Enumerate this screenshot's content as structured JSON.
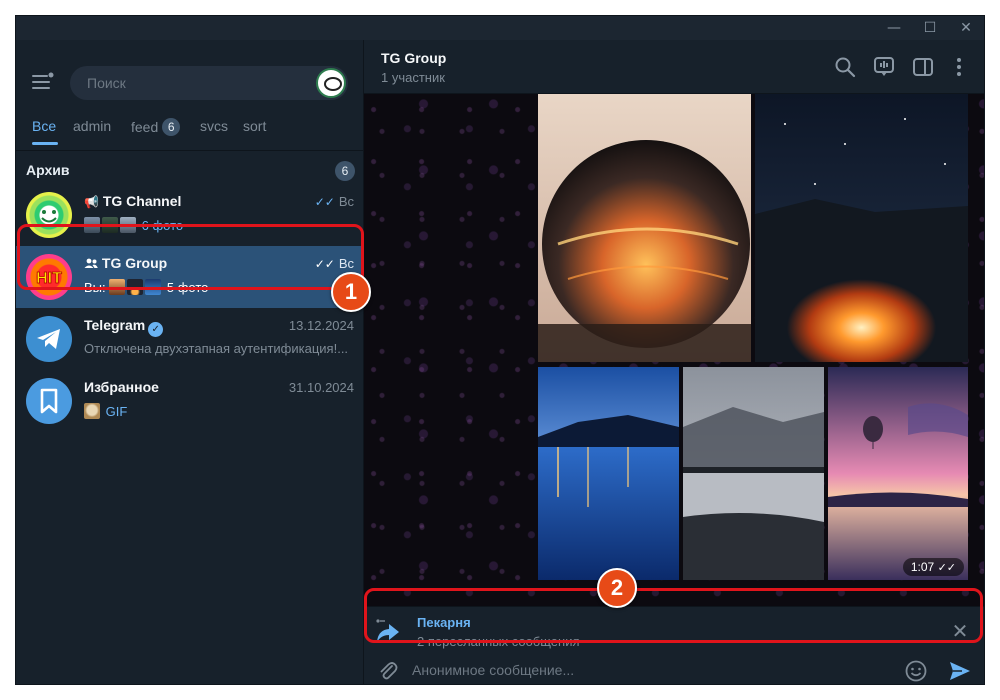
{
  "window": {
    "controls": [
      "—",
      "☐",
      "✕"
    ]
  },
  "sidebar": {
    "search_placeholder": "Поиск",
    "tabs": [
      {
        "label": "Все",
        "active": true
      },
      {
        "label": "admin"
      },
      {
        "label": "feed",
        "badge": "6"
      },
      {
        "label": "svcs"
      },
      {
        "label": "sort"
      }
    ],
    "archive": {
      "label": "Архив",
      "count": "6"
    },
    "chats": [
      {
        "title": "TG Channel",
        "prefix_icon": "megaphone-icon",
        "time": "Вс",
        "status": "read-ticks",
        "preview_prefix": "",
        "preview_text": "6 фото",
        "thumbs": [
          "#4a5a6e",
          "#2f3c47",
          "#6d7f92"
        ]
      },
      {
        "title": "TG Group",
        "prefix_icon": "group-icon",
        "time": "Вс",
        "status": "read-ticks",
        "preview_prefix": "Вы:",
        "preview_text": "5 фото",
        "thumbs": [
          "#c9873f",
          "#2c2f3e",
          "#2f6fb0"
        ],
        "selected": true
      },
      {
        "title": "Telegram",
        "verified": true,
        "time": "13.12.2024",
        "preview_text": "Отключена двухэтапная аутентификация!..."
      },
      {
        "title": "Избранное",
        "time": "31.10.2024",
        "preview_text": "GIF",
        "thumbs": [
          "#c9b38a"
        ]
      }
    ]
  },
  "header": {
    "title": "TG Group",
    "subtitle": "1 участник",
    "icons": [
      "search-icon",
      "live-stream-icon",
      "sidebar-toggle-icon",
      "more-vertical-icon"
    ]
  },
  "album": {
    "photo_count": 5,
    "time": "1:07",
    "status": "read-ticks"
  },
  "forward": {
    "title": "Пекарня",
    "subtitle": "2 пересланных сообщения"
  },
  "composer": {
    "placeholder": "Анонимное сообщение..."
  },
  "annotations": {
    "marker_1": "1",
    "marker_2": "2"
  },
  "colors": {
    "accent": "#6ab3f3",
    "selected": "#2b5278",
    "sidebar_bg": "#17212b",
    "callout": "#e0141b",
    "marker": "#e74a17"
  }
}
